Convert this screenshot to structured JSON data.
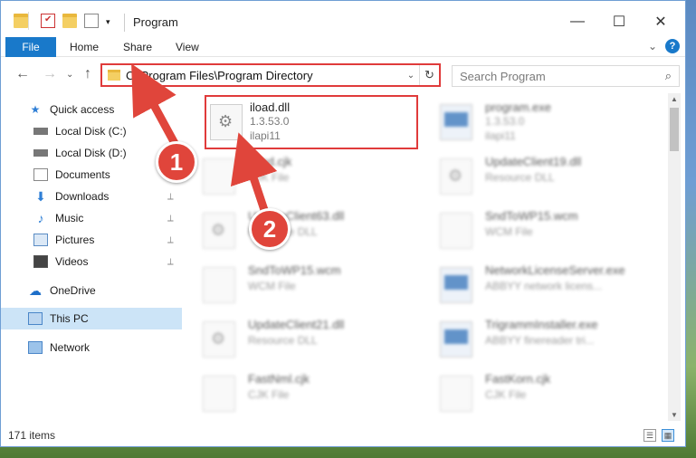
{
  "window": {
    "title": "Program",
    "minimize": "—",
    "maximize": "☐",
    "close": "✕"
  },
  "ribbon": {
    "tabs": [
      "File",
      "Home",
      "Share",
      "View"
    ],
    "expand": "⌄",
    "help": "?"
  },
  "nav": {
    "back": "←",
    "forward": "→",
    "recent": "⌄",
    "up": "↑"
  },
  "address": {
    "path": "C:\\Program Files\\Program Directory",
    "chevron": "⌄",
    "refresh": "↻"
  },
  "search": {
    "placeholder": "Search Program",
    "icon": "⌕"
  },
  "sidebar": {
    "items": [
      {
        "label": "Quick access",
        "icon": "star-icon"
      },
      {
        "label": "Local Disk (C:)",
        "icon": "drive-icon"
      },
      {
        "label": "Local Disk (D:)",
        "icon": "drive-icon"
      },
      {
        "label": "Documents",
        "icon": "documents-icon"
      },
      {
        "label": "Downloads",
        "icon": "download-icon"
      },
      {
        "label": "Music",
        "icon": "music-icon"
      },
      {
        "label": "Pictures",
        "icon": "pictures-icon"
      },
      {
        "label": "Videos",
        "icon": "videos-icon"
      },
      {
        "label": "OneDrive",
        "icon": "cloud-icon"
      },
      {
        "label": "This PC",
        "icon": "computer-icon"
      },
      {
        "label": "Network",
        "icon": "network-icon"
      }
    ],
    "pin_glyph": "📌"
  },
  "files": [
    {
      "name": "iload.dll",
      "line1": "1.3.53.0",
      "line2": "ilapi11"
    },
    {
      "name": "program.exe",
      "line1": "1.3.53.0",
      "line2": "ilapi11"
    },
    {
      "name": "rload.cjk",
      "line1": "CJK File",
      "line2": ""
    },
    {
      "name": "UpdateClient19.dll",
      "line1": "Resource DLL",
      "line2": ""
    },
    {
      "name": "UpdateClient63.dll",
      "line1": "Resource DLL",
      "line2": ""
    },
    {
      "name": "SndToWP15.wcm",
      "line1": "WCM File",
      "line2": ""
    },
    {
      "name": "SndToWP15.wcm",
      "line1": "WCM File",
      "line2": ""
    },
    {
      "name": "NetworkLicenseServer.exe",
      "line1": "ABBYY network licens...",
      "line2": ""
    },
    {
      "name": "UpdateClient21.dll",
      "line1": "Resource DLL",
      "line2": ""
    },
    {
      "name": "TrigrammInstaller.exe",
      "line1": "ABBYY finereader tri...",
      "line2": ""
    },
    {
      "name": "FastNml.cjk",
      "line1": "CJK File",
      "line2": ""
    },
    {
      "name": "FastKorn.cjk",
      "line1": "CJK File",
      "line2": ""
    }
  ],
  "status": {
    "count": "171 items"
  },
  "callouts": {
    "one": "1",
    "two": "2",
    "color": "#e0453b"
  }
}
